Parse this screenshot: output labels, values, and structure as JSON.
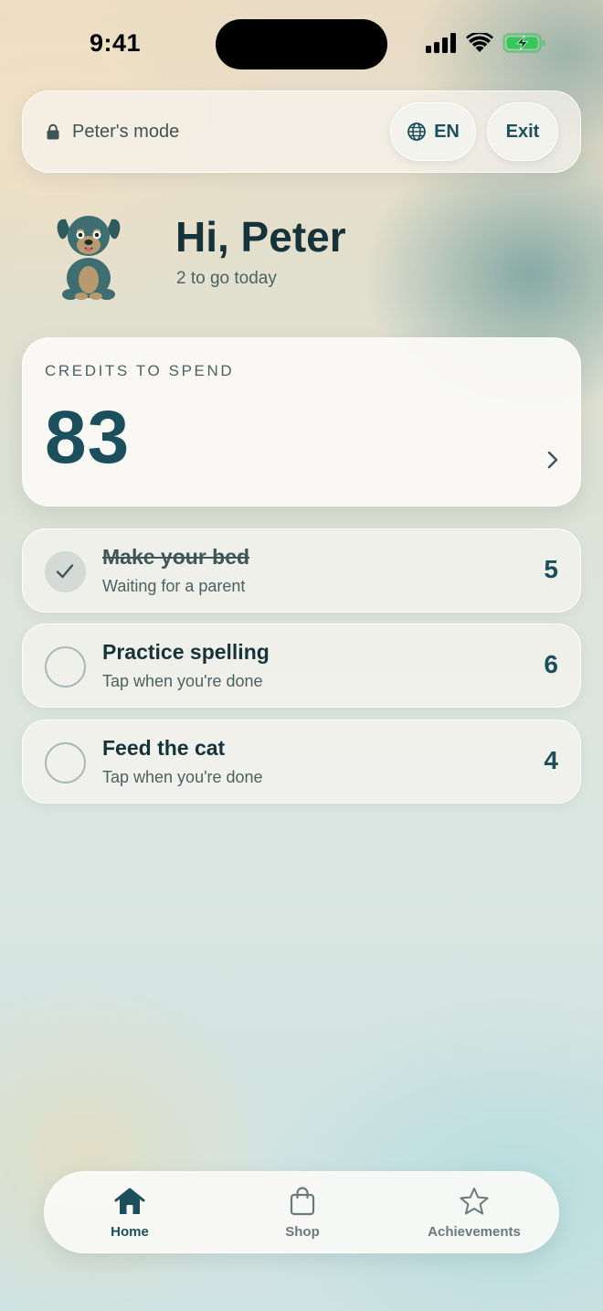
{
  "status_bar": {
    "time": "9:41"
  },
  "header": {
    "mode_label": "Peter's mode",
    "language_label": "EN",
    "exit_label": "Exit"
  },
  "greeting": {
    "title": "Hi, Peter",
    "subtitle": "2 to go today",
    "avatar_icon": "dog-avatar"
  },
  "credits": {
    "label": "CREDITS TO SPEND",
    "value": "83"
  },
  "tasks": [
    {
      "title": "Make your bed",
      "status": "Waiting for a parent",
      "credits": "5",
      "completed": true
    },
    {
      "title": "Practice spelling",
      "status": "Tap when you're done",
      "credits": "6",
      "completed": false
    },
    {
      "title": "Feed the cat",
      "status": "Tap when you're done",
      "credits": "4",
      "completed": false
    }
  ],
  "nav": {
    "items": [
      {
        "label": "Home",
        "icon": "home-icon",
        "active": true
      },
      {
        "label": "Shop",
        "icon": "shopping-bag-icon",
        "active": false
      },
      {
        "label": "Achievements",
        "icon": "star-icon",
        "active": false
      }
    ]
  },
  "colors": {
    "accent": "#1b4f5c",
    "text": "#17333a",
    "battery": "#34c759"
  }
}
